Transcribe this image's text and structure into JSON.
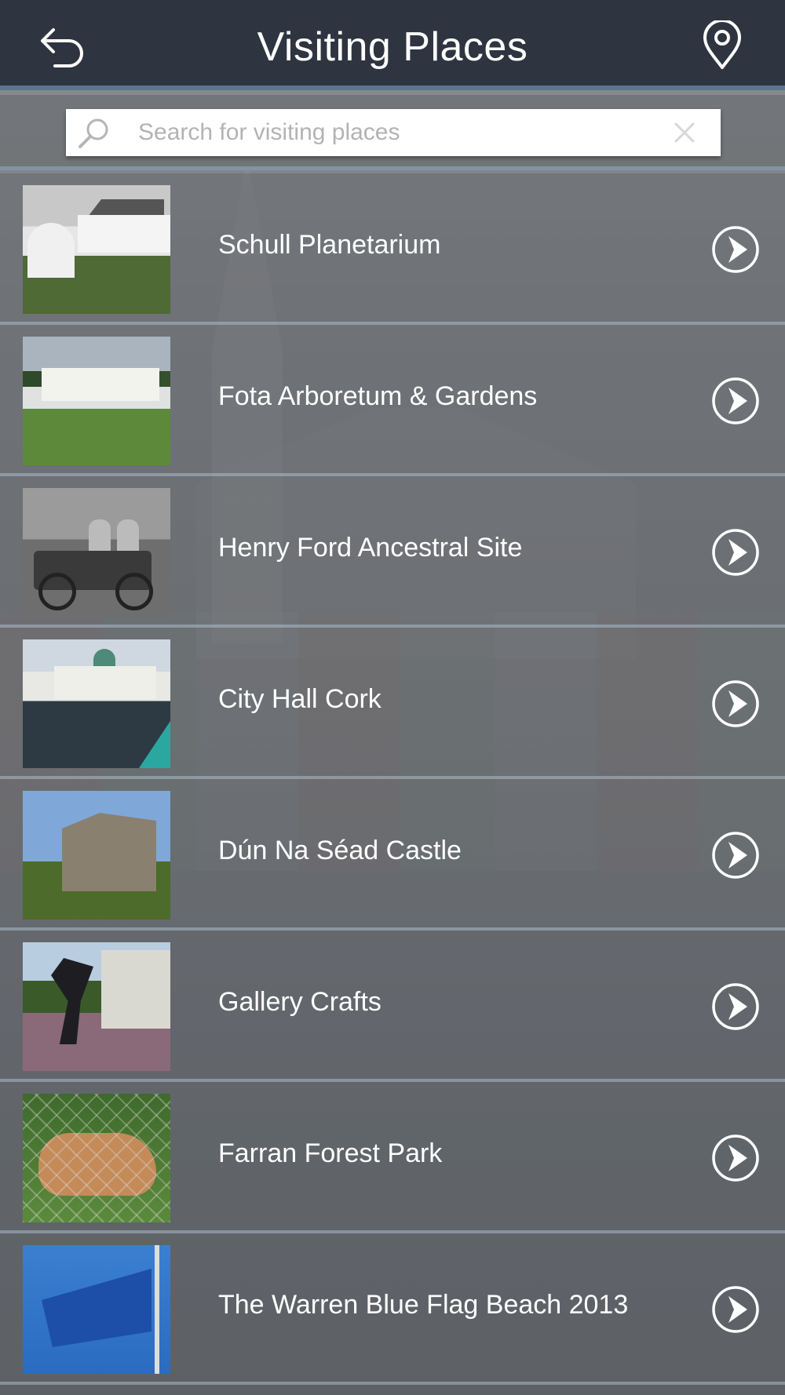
{
  "header": {
    "title": "Visiting Places",
    "back_icon": "back-arrow-icon",
    "map_icon": "map-pin-icon"
  },
  "search": {
    "placeholder": "Search for visiting places",
    "value": ""
  },
  "places": [
    {
      "name": "Schull Planetarium"
    },
    {
      "name": "Fota Arboretum & Gardens"
    },
    {
      "name": "Henry Ford Ancestral Site"
    },
    {
      "name": "City Hall Cork"
    },
    {
      "name": "Dún Na Séad Castle"
    },
    {
      "name": "Gallery Crafts"
    },
    {
      "name": "Farran Forest Park"
    },
    {
      "name": "The Warren Blue Flag Beach 2013"
    }
  ],
  "colors": {
    "header_bg": "#2e3540",
    "accent_border": "#5b7590",
    "text": "#ffffff"
  }
}
